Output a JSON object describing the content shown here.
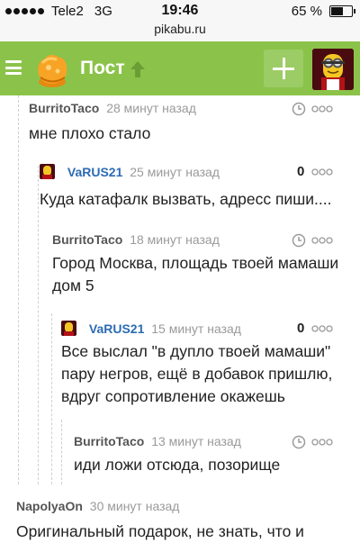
{
  "status_bar": {
    "carrier": "Tele2",
    "network": "3G",
    "time": "19:46",
    "battery": "65 %",
    "battery_level": 0.65
  },
  "browser": {
    "url": "pikabu.ru"
  },
  "header": {
    "title": "Пост",
    "menu_icon": "menu-icon",
    "logo_icon": "pikabu-logo-icon",
    "arrow_icon": "arrow-up-icon",
    "add_icon": "plus-icon",
    "brand_color": "#8bc34a"
  },
  "comments": [
    {
      "author": "BurritoTaco",
      "time": "28 минут назад",
      "lines": [
        "мне плохо стало"
      ],
      "rating": ""
    },
    {
      "author": "VaRUS21",
      "time": "25 минут назад",
      "lines": [
        "Куда катафалк вызвать, адресс пиши...."
      ],
      "rating": "0"
    },
    {
      "author": "BurritoTaco",
      "time": "18 минут назад",
      "lines": [
        "Город Москва, площадь твоей мамаши",
        "дом 5"
      ],
      "rating": ""
    },
    {
      "author": "VaRUS21",
      "time": "15 минут назад",
      "lines": [
        "Все выслал \"в дупло твоей мамаши\"",
        "пару негров, ещё в добавок пришлю,",
        "вдруг сопротивление окажешь"
      ],
      "rating": "0"
    },
    {
      "author": "BurritoTaco",
      "time": "13 минут назад",
      "lines": [
        "иди ложи отсюда, позорище"
      ],
      "rating": ""
    },
    {
      "author": "NapolyaOn",
      "time": "30 минут назад",
      "lines": [
        "Оригинальный подарок, не знать, что и"
      ],
      "rating": ""
    }
  ],
  "icons": {
    "clock": "clock-icon",
    "more": "more-dots-icon"
  }
}
